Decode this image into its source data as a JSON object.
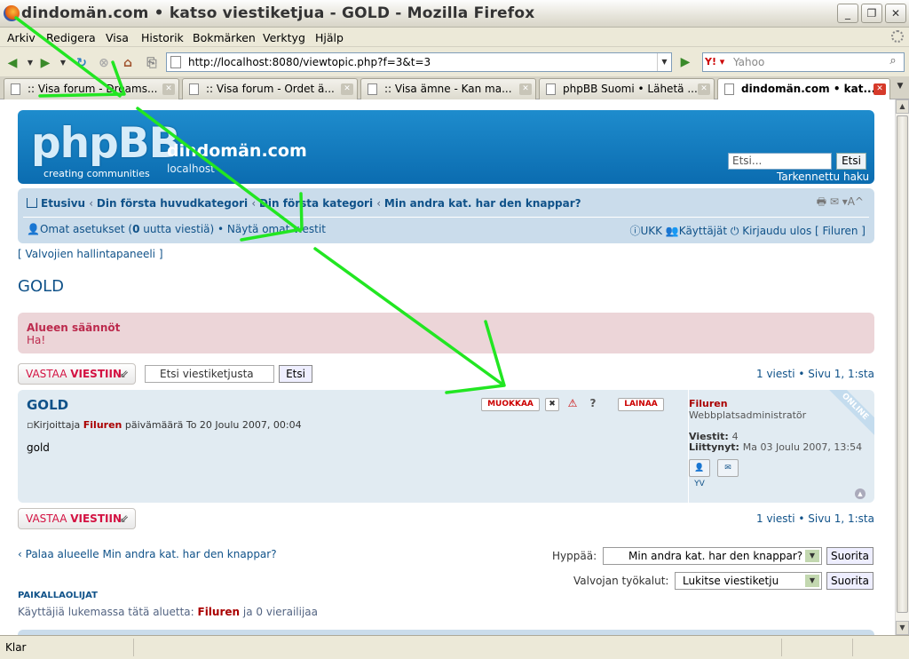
{
  "window": {
    "title": "dindomän.com • katso viestiketjua - GOLD - Mozilla Firefox"
  },
  "menu": [
    "Arkiv",
    "Redigera",
    "Visa",
    "Historik",
    "Bokmärken",
    "Verktyg",
    "Hjälp"
  ],
  "address": {
    "url": "http://localhost:8080/viewtopic.php?f=3&t=3"
  },
  "search_engine": {
    "placeholder": "Yahoo"
  },
  "tabs": [
    {
      "label": ":: Visa forum - Dreams..."
    },
    {
      "label": ":: Visa forum - Ordet ä..."
    },
    {
      "label": ":: Visa ämne - Kan ma..."
    },
    {
      "label": "phpBB Suomi • Lähetä ..."
    },
    {
      "label": "dindomän.com • kat..."
    }
  ],
  "status": {
    "text": "Klar"
  },
  "board": {
    "logo": "phpBB",
    "logo_sub": "creating   communities",
    "site_name": "dindomän.com",
    "site_desc": "localhost",
    "search_placeholder": "Etsi...",
    "search_btn": "Etsi",
    "adv_search": "Tarkennettu haku"
  },
  "breadcrumb": {
    "home": "Etusivu",
    "c1": "Din första huvudkategori",
    "c2": "Din första kategori",
    "c3": "Min andra kat. har den knappar?"
  },
  "navtools": "🖶  ✉  ▾A^",
  "userbar": {
    "settings": "Omat asetukset",
    "new_count": "0",
    "new_label": "uutta viestiä",
    "own_posts": "Näytä omat viestit",
    "faq": "UKK",
    "members": "Käyttäjät",
    "logout": "Kirjaudu ulos [ Filuren ]"
  },
  "mcp": "[ Valvojien hallintapaneeli ]",
  "topic": {
    "title": "GOLD"
  },
  "rules": {
    "heading": "Alueen säännöt",
    "text": "Ha!"
  },
  "actions": {
    "reply_a": "VASTAA ",
    "reply_b": "VIESTIIN",
    "topic_search_placeholder": "Etsi viestiketjusta",
    "topic_search_btn": "Etsi",
    "pagination": "1 viesti • Sivu 1, 1:sta"
  },
  "post": {
    "title": "GOLD",
    "author_prefix": "Kirjoittaja ",
    "author": "Filuren",
    "date": " päivämäärä To 20 Joulu 2007, 00:04",
    "body": "gold",
    "buttons": {
      "edit": "MUOKKAA",
      "quote": "LAINAA"
    },
    "online": "ONLINE"
  },
  "profile": {
    "name": "Filuren",
    "rank": "Webbplatsadministratör",
    "posts_label": "Viestit: ",
    "posts": "4",
    "joined_label": "Liittynyt: ",
    "joined": "Ma 03 Joulu 2007, 13:54",
    "pm": "YV"
  },
  "footer": {
    "back": "Palaa alueelle Min andra kat. har den knappar?",
    "jump_label": "Hyppää:",
    "jump_value": "Min andra kat. har den knappar?",
    "jump_btn": "Suorita",
    "tools_label": "Valvojan työkalut:",
    "tools_value": "Lukitse viestiketju",
    "tools_btn": "Suorita",
    "wio_heading": "PAIKALLAOLIJAT",
    "wio_prefix": "Käyttäjiä lukemassa tätä aluetta: ",
    "wio_user": "Filuren",
    "wio_suffix": " ja 0 vierailijaa"
  },
  "colors": {
    "annotation": "#22e622",
    "header": "#0b6cb0",
    "link": "#105289"
  }
}
